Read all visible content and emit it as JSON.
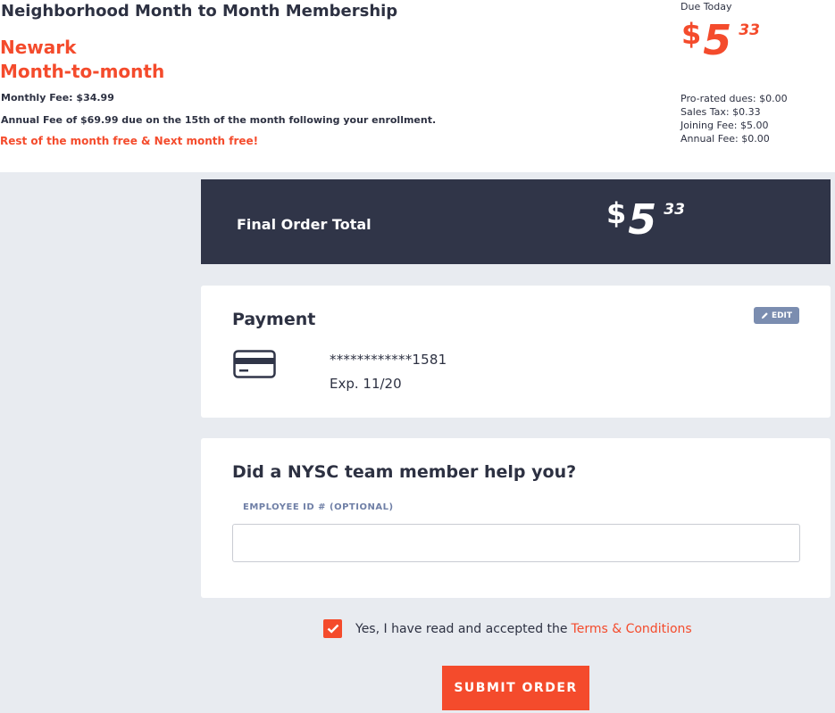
{
  "membership": {
    "plan_name": "Neighborhood Month to Month Membership",
    "club": "Newark",
    "term": "Month-to-month",
    "monthly_fee": "Monthly Fee: $34.99",
    "annual_fee_note": "Annual Fee of $69.99 due on the 15th of the month following your enrollment.",
    "promo": "Rest of the month free & Next month free!"
  },
  "due_today": {
    "label": "Due Today",
    "currency": "$",
    "dollars": "5",
    "cents": "33",
    "breakdown": [
      "Pro-rated dues: $0.00",
      "Sales Tax: $0.33",
      "Joining Fee: $5.00",
      "Annual Fee: $0.00"
    ]
  },
  "final_total": {
    "label": "Final Order Total",
    "currency": "$",
    "dollars": "5",
    "cents": "33"
  },
  "payment": {
    "title": "Payment",
    "edit_label": "EDIT",
    "card_masked": "************1581",
    "expiry": "Exp. 11/20",
    "icon": "credit-card-icon"
  },
  "employee": {
    "title": "Did a NYSC team member help you?",
    "field_label": "EMPLOYEE ID # (OPTIONAL)",
    "value": "",
    "placeholder": ""
  },
  "terms": {
    "checked": true,
    "text": "Yes, I have read and accepted the",
    "link": "Terms & Conditions"
  },
  "submit_label": "SUBMIT ORDER",
  "colors": {
    "accent": "#f44b2c",
    "dark": "#303548",
    "edit_badge": "#7b8db0",
    "background": "#e8ebf0"
  }
}
